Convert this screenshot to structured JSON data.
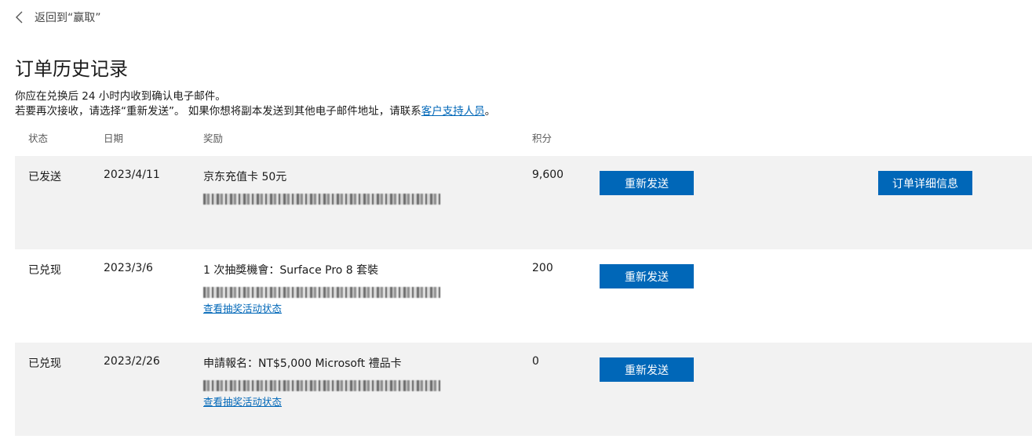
{
  "nav": {
    "back_label": "返回到“赢取”",
    "back_icon": "chevron-left-icon"
  },
  "page": {
    "title": "订单历史记录",
    "info_line1": "你应在兑换后 24 小时内收到确认电子邮件。",
    "info_line2_prefix": "若要再次接收，请选择“重新发送”。 如果你想将副本发送到其他电子邮件地址，请联系",
    "support_link": "客户支持人员",
    "info_line2_suffix": "。"
  },
  "table": {
    "headers": {
      "status": "状态",
      "date": "日期",
      "reward": "奖励",
      "points": "积分"
    },
    "rows": [
      {
        "status": "已发送",
        "date": "2023/4/11",
        "reward": "京东充值卡 50元",
        "code": "■■■■ ■■■■ ■■■■ ■■■■ ■■■■",
        "points": "9,600",
        "resend_label": "重新发送",
        "details_label": "订单详细信息"
      },
      {
        "status": "已兑现",
        "date": "2023/3/6",
        "reward": "1 次抽獎機會：Surface Pro 8 套裝",
        "code": "■■■■ ■■■■ ■■■■ ■■■■ ■■■■",
        "link_label": "查看抽奖活动状态",
        "points": "200",
        "resend_label": "重新发送"
      },
      {
        "status": "已兑现",
        "date": "2023/2/26",
        "reward": "申請報名：NT$5,000 Microsoft 禮品卡",
        "code": "■■■■ ■■■■ ■■■■ ■■■■ ■■■■",
        "link_label": "查看抽奖活动状态",
        "points": "0",
        "resend_label": "重新发送"
      }
    ]
  },
  "colors": {
    "accent": "#0067b8",
    "row_shade": "#f2f2f2"
  }
}
